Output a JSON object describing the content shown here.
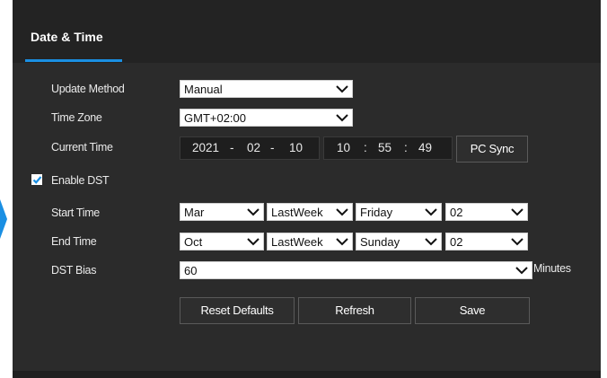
{
  "header": {
    "title": "Date & Time"
  },
  "colors": {
    "accent": "#1a8fe3",
    "panel": "#2b2b2b"
  },
  "form": {
    "update_method": {
      "label": "Update Method",
      "value": "Manual"
    },
    "time_zone": {
      "label": "Time Zone",
      "value": "GMT+02:00"
    },
    "current_time": {
      "label": "Current Time",
      "date": {
        "year": "2021",
        "month": "02",
        "day": "10",
        "sep": "-"
      },
      "time": {
        "hour": "10",
        "minute": "55",
        "second": "49",
        "sep": ":"
      },
      "pc_sync_label": "PC Sync"
    },
    "enable_dst": {
      "label": "Enable DST",
      "checked": true
    },
    "start_time": {
      "label": "Start Time",
      "month": "Mar",
      "week": "LastWeek",
      "weekday": "Friday",
      "hour": "02"
    },
    "end_time": {
      "label": "End Time",
      "month": "Oct",
      "week": "LastWeek",
      "weekday": "Sunday",
      "hour": "02"
    },
    "dst_bias": {
      "label": "DST Bias",
      "value": "60",
      "unit": "Minutes"
    }
  },
  "buttons": {
    "reset_defaults": "Reset Defaults",
    "refresh": "Refresh",
    "save": "Save"
  }
}
